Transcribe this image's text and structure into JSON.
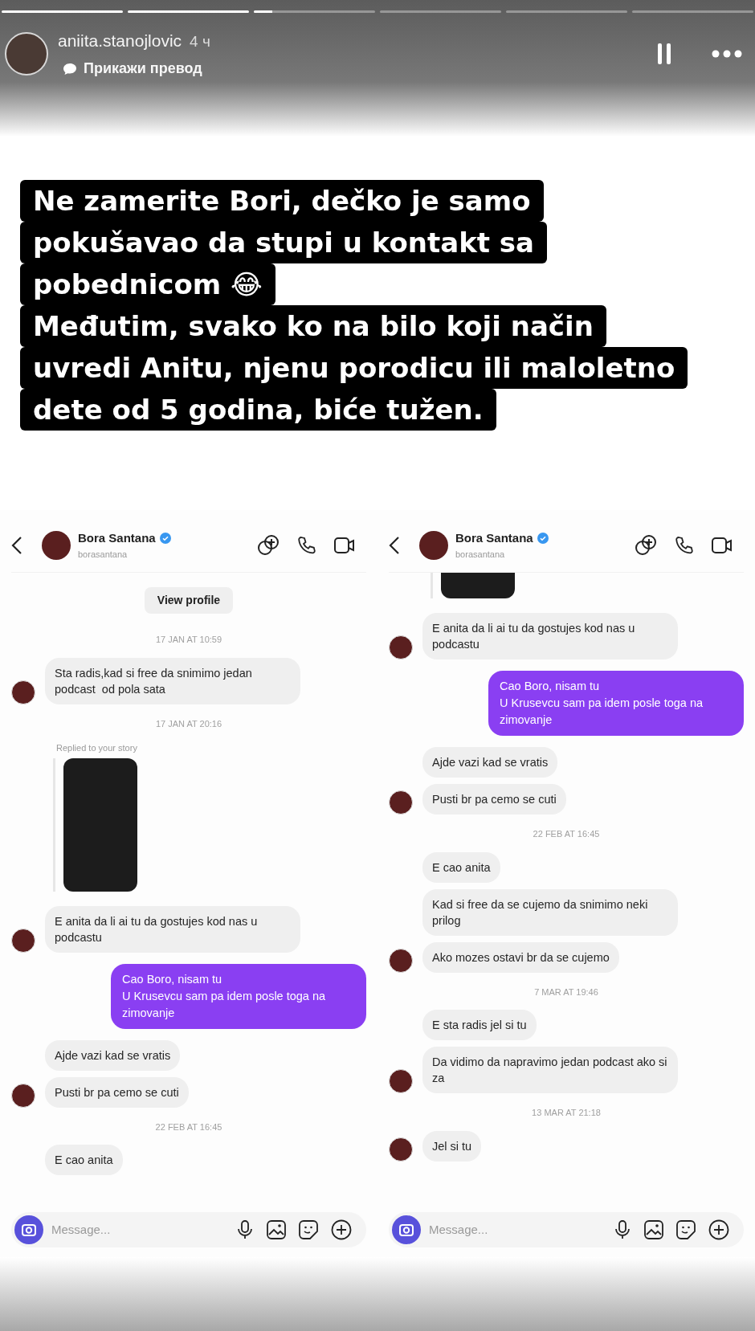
{
  "story": {
    "progress": [
      {
        "level": 1
      },
      {
        "level": 1
      },
      {
        "level": 0.15
      },
      {
        "level": 0
      },
      {
        "level": 0
      },
      {
        "level": 0
      }
    ],
    "user": {
      "name": "aniita.stanojlovic",
      "time": "4 ч"
    },
    "translate": "Прикажи превод"
  },
  "caption": {
    "lines": [
      "Ne zamerite Bori, dečko je samo",
      "pokušavao da stupi u kontakt sa",
      "pobednicom 😂",
      "Međutim, svako ko na bilo koji način",
      "uvredi Anitu, njenu porodicu ili maloletno",
      "dete od 5 godina, biće tužen."
    ]
  },
  "chats": [
    {
      "contact": {
        "name": "Bora Santana",
        "handle": "borasantana",
        "verified": true
      },
      "messages": [
        {
          "kind": "button",
          "text": "View profile"
        },
        {
          "kind": "date",
          "text": "17 JAN AT 10:59"
        },
        {
          "kind": "in",
          "text": "Sta radis,kad si free da snimimo jedan podcast  od pola sata",
          "avatar": true
        },
        {
          "kind": "date",
          "text": "17 JAN AT 20:16"
        },
        {
          "kind": "reply_label",
          "text": "Replied to your story"
        },
        {
          "kind": "story_image"
        },
        {
          "kind": "in",
          "text": "E anita da li ai tu da gostujes kod nas u podcastu",
          "avatar": true
        },
        {
          "kind": "out",
          "text": "Cao Boro, nisam tu\nU Krusevcu sam pa idem posle toga na zimovanje"
        },
        {
          "kind": "in",
          "text": "Ajde vazi kad se vratis",
          "avatar": false
        },
        {
          "kind": "in",
          "text": "Pusti br pa cemo se cuti",
          "avatar": true
        },
        {
          "kind": "date",
          "text": "22 FEB AT 16:45"
        },
        {
          "kind": "in",
          "text": "E cao anita",
          "avatar": false
        }
      ],
      "composer": {
        "placeholder": "Message..."
      }
    },
    {
      "contact": {
        "name": "Bora Santana",
        "handle": "borasantana",
        "verified": true
      },
      "messages": [
        {
          "kind": "story_image_tail"
        },
        {
          "kind": "in",
          "text": "E anita da li ai tu da gostujes kod nas u podcastu",
          "avatar": true
        },
        {
          "kind": "out",
          "text": "Cao Boro, nisam tu\nU Krusevcu sam pa idem posle toga na zimovanje"
        },
        {
          "kind": "in",
          "text": "Ajde vazi kad se vratis",
          "avatar": false
        },
        {
          "kind": "in",
          "text": "Pusti br pa cemo se cuti",
          "avatar": true
        },
        {
          "kind": "date",
          "text": "22 FEB AT 16:45"
        },
        {
          "kind": "in",
          "text": "E cao anita",
          "avatar": false
        },
        {
          "kind": "in",
          "text": "Kad si free da se cujemo da snimimo neki prilog",
          "avatar": false
        },
        {
          "kind": "in",
          "text": "Ako mozes ostavi br da se cujemo",
          "avatar": true
        },
        {
          "kind": "date",
          "text": "7 MAR AT 19:46"
        },
        {
          "kind": "in",
          "text": "E sta radis jel si tu",
          "avatar": false
        },
        {
          "kind": "in",
          "text": "Da vidimo da napravimo jedan podcast ako si za",
          "avatar": true
        },
        {
          "kind": "date",
          "text": "13 MAR AT 21:18"
        },
        {
          "kind": "in",
          "text": "Jel si tu",
          "avatar": true
        }
      ],
      "composer": {
        "placeholder": "Message..."
      }
    }
  ]
}
